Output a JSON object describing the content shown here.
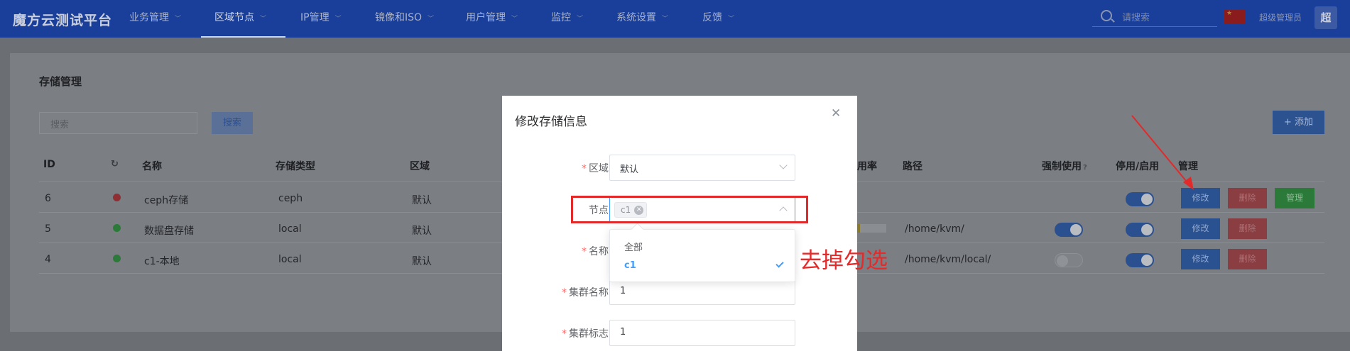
{
  "app": {
    "brand": "魔方云测试平台"
  },
  "nav": {
    "items": [
      {
        "label": "业务管理"
      },
      {
        "label": "区域节点"
      },
      {
        "label": "IP管理"
      },
      {
        "label": "镜像和ISO"
      },
      {
        "label": "用户管理"
      },
      {
        "label": "监控"
      },
      {
        "label": "系统设置"
      },
      {
        "label": "反馈"
      }
    ],
    "search_placeholder": "请搜索",
    "user": "超级管理员",
    "avatar": "超"
  },
  "page": {
    "title": "存储管理",
    "search_placeholder": "搜索",
    "search_button": "搜索",
    "add_button": "+ 添加"
  },
  "table": {
    "headers": {
      "id": "ID",
      "name": "名称",
      "type": "存储类型",
      "area": "区域",
      "rate": "用率",
      "path": "路径",
      "force": "强制使用",
      "enable": "停用/启用",
      "manage": "管理"
    },
    "rows": [
      {
        "id": "6",
        "status": "error",
        "name": "ceph存储",
        "type": "ceph",
        "area": "默认",
        "path": "",
        "force": null,
        "enabled": true,
        "actions": [
          "修改",
          "删除",
          "管理"
        ]
      },
      {
        "id": "5",
        "status": "ok",
        "name": "数据盘存储",
        "type": "local",
        "area": "默认",
        "path": "/home/kvm/",
        "force": true,
        "enabled": true,
        "actions": [
          "修改",
          "删除"
        ]
      },
      {
        "id": "4",
        "status": "ok",
        "name": "c1-本地",
        "type": "local",
        "area": "默认",
        "path": "/home/kvm/local/",
        "force": false,
        "enabled": true,
        "actions": [
          "修改",
          "删除"
        ]
      }
    ]
  },
  "modal": {
    "title": "修改存储信息",
    "fields": {
      "area": {
        "label": "区域",
        "value": "默认"
      },
      "node": {
        "label": "节点",
        "tag": "c1"
      },
      "name": {
        "label": "名称"
      },
      "cluster_name": {
        "label": "集群名称",
        "value": "1"
      },
      "cluster_id": {
        "label": "集群标志",
        "value": "1"
      }
    },
    "dropdown": [
      {
        "label": "全部",
        "selected": false
      },
      {
        "label": "c1",
        "selected": true
      }
    ]
  },
  "annotation": {
    "note": "去掉勾选"
  },
  "colors": {
    "nav_bg": "#1a3f9a",
    "primary": "#409eff",
    "annotation": "#e22a2a"
  }
}
